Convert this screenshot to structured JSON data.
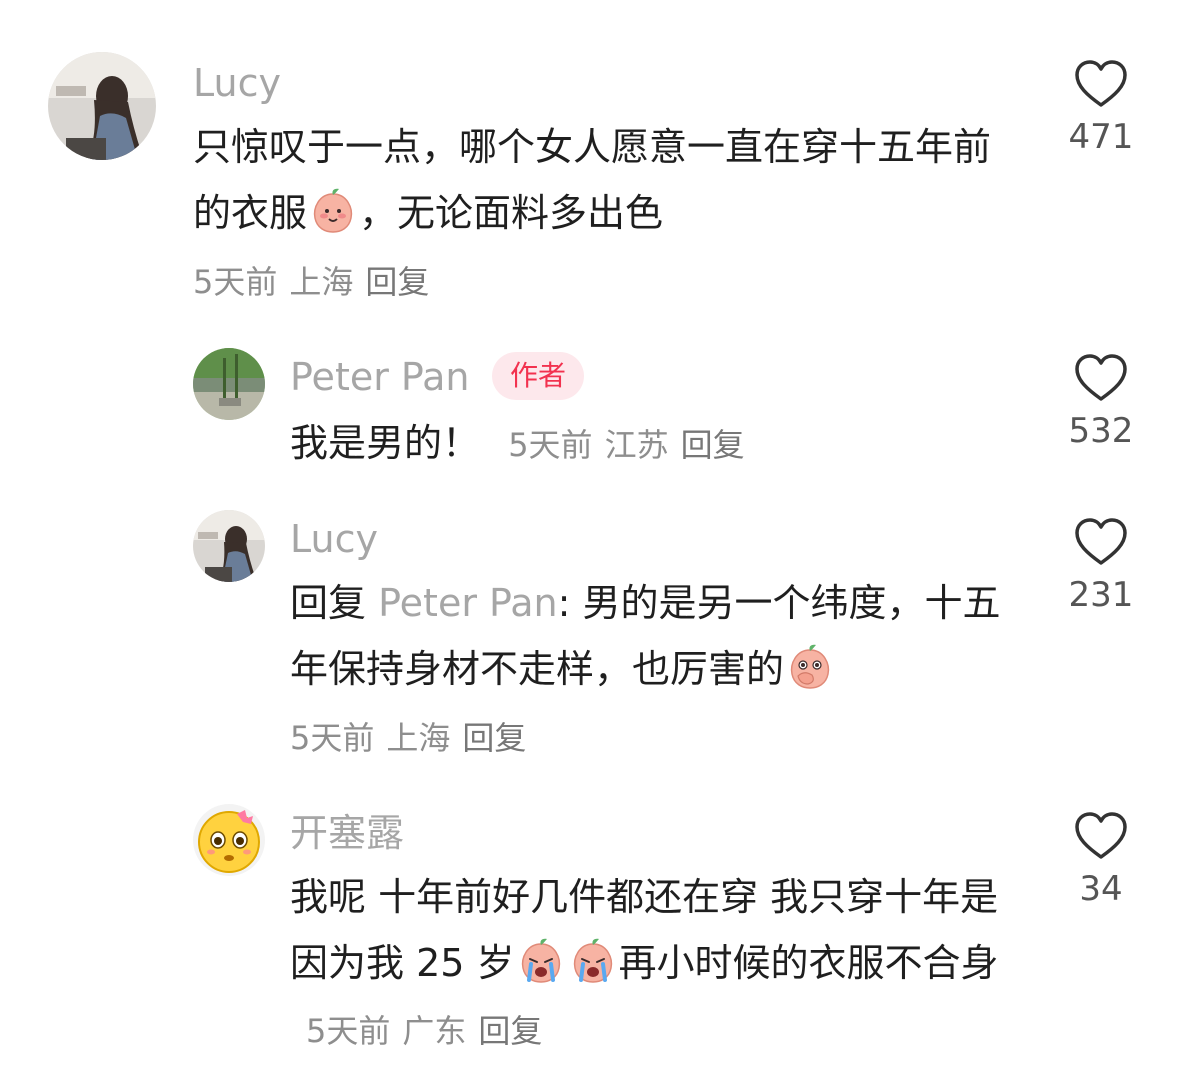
{
  "comments": [
    {
      "user": "Lucy",
      "text_before": "只惊叹于一点，哪个女人愿意一直在穿十五年前的衣服",
      "emoji": "smiling-peach-emoji",
      "text_after": "，无论面料多出色",
      "time": "5天前",
      "location": "上海",
      "reply_label": "回复",
      "likes": "471"
    },
    {
      "user": "Peter Pan",
      "badge": "作者",
      "text": "我是男的！",
      "time": "5天前",
      "location": "江苏",
      "reply_label": "回复",
      "likes": "532"
    },
    {
      "user": "Lucy",
      "reply_prefix": "回复",
      "reply_target": "Peter Pan",
      "text_before": ": 男的是另一个纬度，十五年保持身材不走样，也厉害的",
      "emoji": "covering-mouth-peach-emoji",
      "time": "5天前",
      "location": "上海",
      "reply_label": "回复",
      "likes": "231"
    },
    {
      "user": "开塞露",
      "text_before": "我呢 十年前好几件都还在穿 我只穿十年是因为我 25 岁",
      "emoji": "crying-peach-emoji",
      "text_after": "再小时候的衣服不合身",
      "time": "5天前",
      "location": "广东",
      "reply_label": "回复",
      "likes": "34"
    }
  ],
  "colors": {
    "name": "#a6a6a6",
    "text": "#1f1f1f",
    "meta": "#8e8e8e",
    "badge_text": "#f2324f",
    "badge_bg": "#fde8ec",
    "heart_stroke": "#333333"
  }
}
